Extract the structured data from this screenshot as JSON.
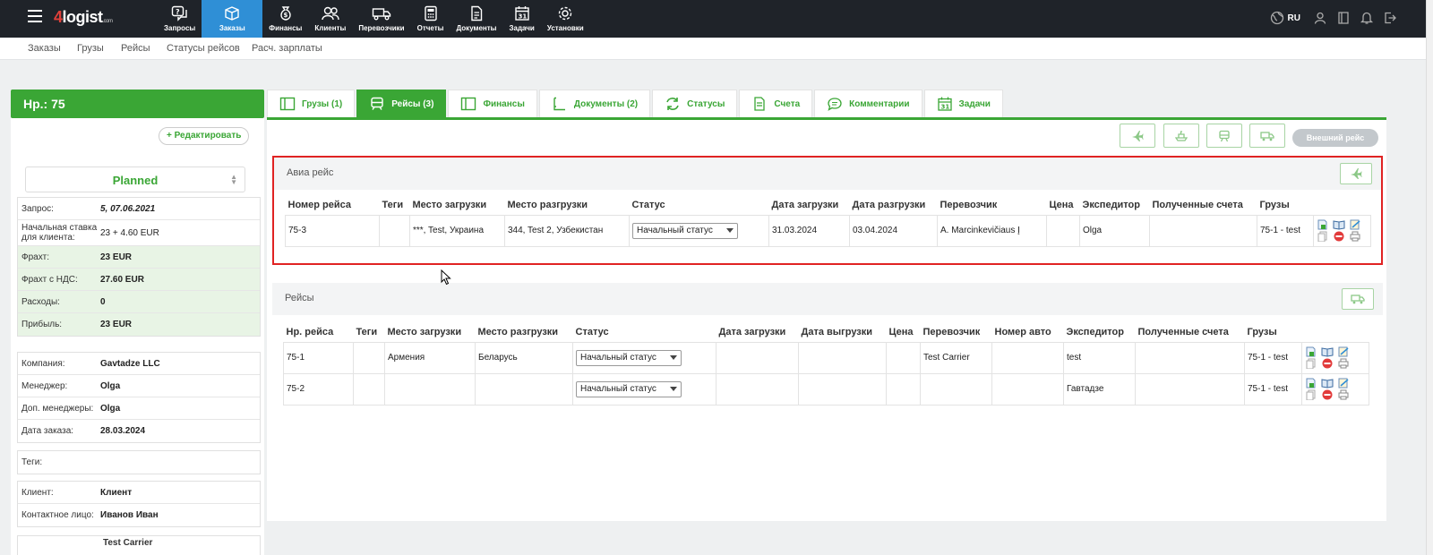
{
  "app": {
    "logo_four": "4",
    "logo_text": "logist",
    "logo_suffix": ".com"
  },
  "nav": [
    {
      "id": "requests",
      "label": "Запросы",
      "icon": "question-bubble-icon"
    },
    {
      "id": "orders",
      "label": "Заказы",
      "icon": "box-icon",
      "active": true
    },
    {
      "id": "finance",
      "label": "Финансы",
      "icon": "money-bag-icon"
    },
    {
      "id": "clients",
      "label": "Клиенты",
      "icon": "users-icon"
    },
    {
      "id": "carriers",
      "label": "Перевозчики",
      "icon": "truck-icon"
    },
    {
      "id": "reports",
      "label": "Отчеты",
      "icon": "calculator-icon"
    },
    {
      "id": "documents",
      "label": "Документы",
      "icon": "document-icon"
    },
    {
      "id": "tasks",
      "label": "Задачи",
      "icon": "calendar-icon"
    },
    {
      "id": "settings",
      "label": "Установки",
      "icon": "gear-icon"
    }
  ],
  "top_right": {
    "lang": "RU"
  },
  "subnav": [
    "Заказы",
    "Грузы",
    "Рейсы",
    "Статусы рейсов",
    "Расч. зарплаты"
  ],
  "order": {
    "header": "Нр.: 75",
    "edit_label": "Редактировать",
    "status": "Planned",
    "block1": [
      {
        "label": "Запрос:",
        "value": "5, 07.06.2021"
      },
      {
        "label": "Начальная ставка для клиента:",
        "value": "23 + 4.60 EUR"
      },
      {
        "label": "Фрахт:",
        "value": "23 EUR"
      },
      {
        "label": "Фрахт с НДС:",
        "value": "27.60 EUR"
      },
      {
        "label": "Расходы:",
        "value": "0"
      },
      {
        "label": "Прибыль:",
        "value": "23 EUR"
      }
    ],
    "block2": [
      {
        "label": "Компания:",
        "value": "Gavtadze LLC"
      },
      {
        "label": "Менеджер:",
        "value": "Olga"
      },
      {
        "label": "Доп. менеджеры:",
        "value": "Olga"
      },
      {
        "label": "Дата заказа:",
        "value": "28.03.2024"
      }
    ],
    "tags_label": "Теги:",
    "block3": [
      {
        "label": "Клиент:",
        "value": "Клиент"
      },
      {
        "label": "Контактное лицо:",
        "value": "Иванов Иван"
      }
    ],
    "partial_text": "Test Carrier"
  },
  "tabs": [
    {
      "label": "Грузы (1)",
      "icon": "cargo-icon"
    },
    {
      "label": "Рейсы (3)",
      "icon": "bus-icon",
      "active": true
    },
    {
      "label": "Финансы",
      "icon": "finance-icon"
    },
    {
      "label": "Документы (2)",
      "icon": "document-icon"
    },
    {
      "label": "Статусы",
      "icon": "refresh-icon"
    },
    {
      "label": "Счета",
      "icon": "invoice-icon"
    },
    {
      "label": "Комментарии",
      "icon": "comment-icon"
    },
    {
      "label": "Задачи",
      "icon": "calendar-icon"
    }
  ],
  "toolbar": {
    "external_trip": "Внешний рейс"
  },
  "air": {
    "title": "Авиа рейс",
    "columns": [
      "Номер рейса",
      "Теги",
      "Место загрузки",
      "Место разгрузки",
      "Статус",
      "Дата загрузки",
      "Дата разгрузки",
      "Перевозчик",
      "Цена",
      "Экспедитор",
      "Полученные счета",
      "Грузы"
    ],
    "rows": [
      {
        "num": "75-3",
        "tags": "",
        "load": "***, Test, Украина",
        "unload": "344, Test 2, Узбекистан",
        "status": "Начальный статус",
        "load_date": "31.03.2024",
        "unload_date": "03.04.2024",
        "carrier": "A. Marcinkevičiaus Į",
        "price": "",
        "forwarder": "Olga",
        "invoices": "",
        "cargo": "75-1 - test"
      }
    ]
  },
  "trips": {
    "title": "Рейсы",
    "columns": [
      "Нр. рейса",
      "Теги",
      "Место загрузки",
      "Место разгрузки",
      "Статус",
      "Дата загрузки",
      "Дата выгрузки",
      "Цена",
      "Перевозчик",
      "Номер авто",
      "Экспедитор",
      "Полученные счета",
      "Грузы"
    ],
    "rows": [
      {
        "num": "75-1",
        "tags": "",
        "load": "Армения",
        "unload": "Беларусь",
        "status": "Начальный статус",
        "load_date": "",
        "unload_date": "",
        "price": "",
        "carrier": "Test Carrier",
        "auto": "",
        "forwarder": "test",
        "invoices": "",
        "cargo": "75-1 - test"
      },
      {
        "num": "75-2",
        "tags": "",
        "load": "",
        "unload": "",
        "status": "Начальный статус",
        "load_date": "",
        "unload_date": "",
        "price": "",
        "carrier": "",
        "auto": "",
        "forwarder": "Гавтадзе",
        "invoices": "",
        "cargo": "75-1 - test"
      }
    ]
  },
  "colors": {
    "green": "#3aa635",
    "blue": "#2f8fd6",
    "dark": "#1f2329",
    "red": "#e02323"
  }
}
